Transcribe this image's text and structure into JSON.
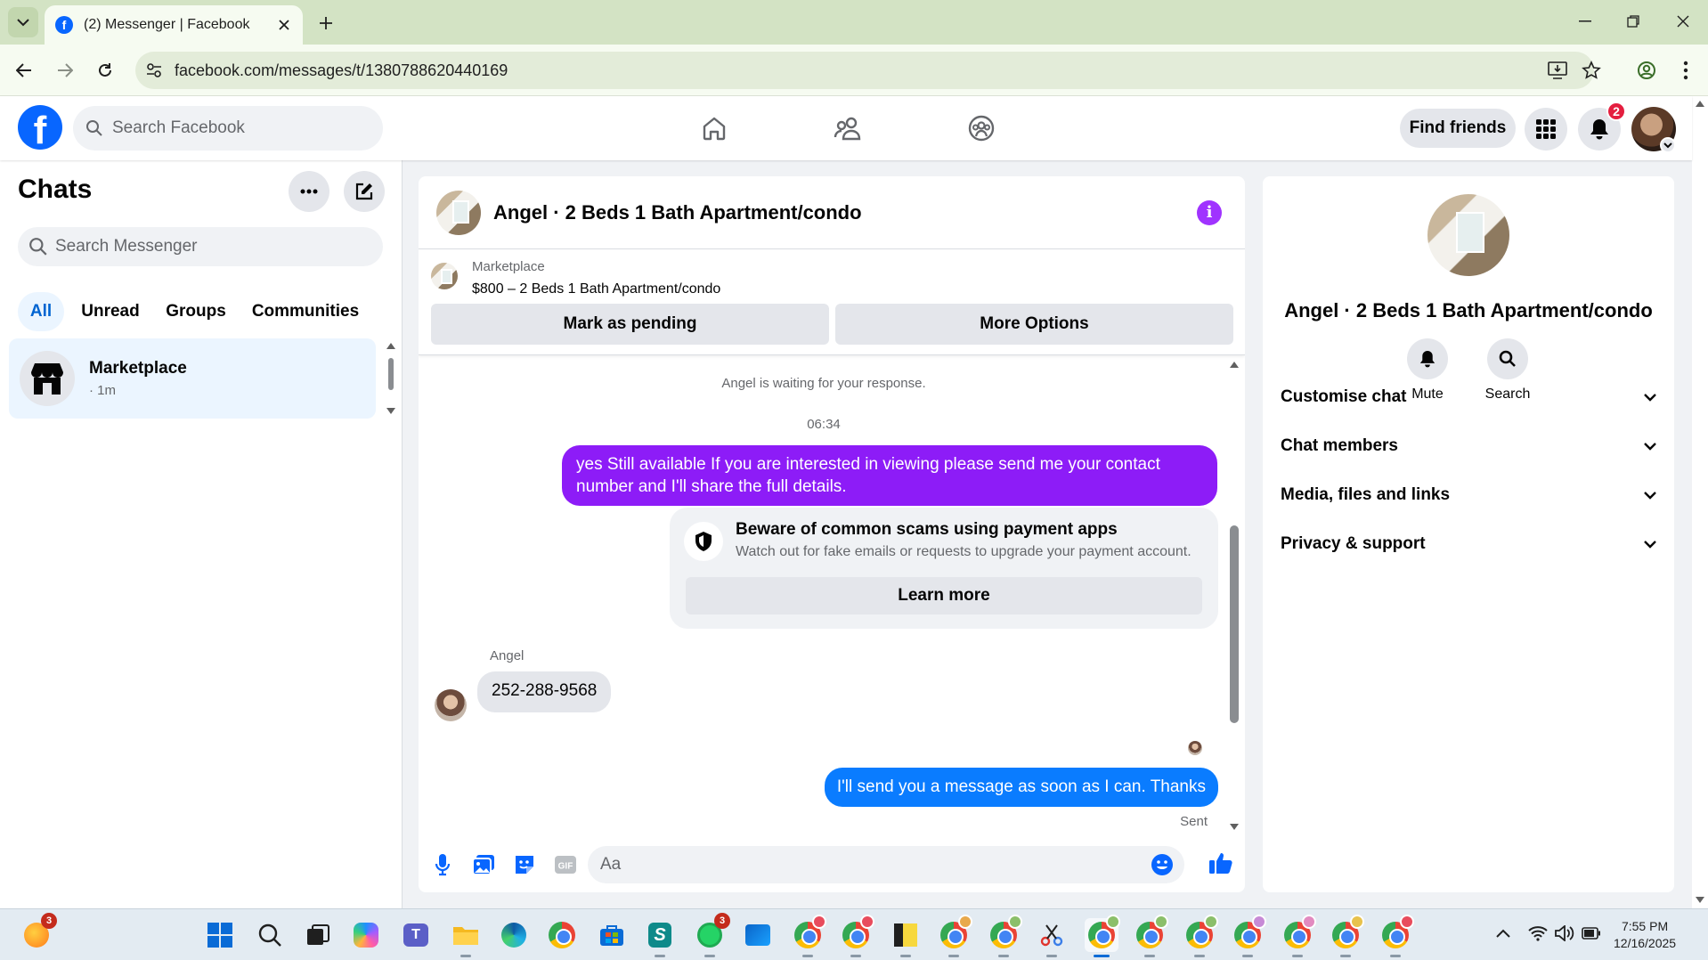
{
  "browser": {
    "tab_title": "(2) Messenger | Facebook",
    "url": "facebook.com/messages/t/1380788620440169"
  },
  "header": {
    "search_placeholder": "Search Facebook",
    "find_friends": "Find friends",
    "notification_count": "2",
    "brand_color": "#0866ff"
  },
  "sidebar": {
    "title": "Chats",
    "search_placeholder": "Search Messenger",
    "filters": [
      "All",
      "Unread",
      "Groups",
      "Communities"
    ],
    "conversations": [
      {
        "name": "Marketplace",
        "time": "· 1m"
      }
    ]
  },
  "chat": {
    "title": "Angel · 2 Beds 1 Bath Apartment/condo",
    "marketplace_label": "Marketplace",
    "listing": "$800 – 2 Beds 1 Bath Apartment/condo",
    "mark_pending": "Mark as pending",
    "more_options": "More Options",
    "waiting_text": "Angel is waiting for your response.",
    "timestamp": "06:34",
    "messages": [
      {
        "from": "me",
        "text": "yes Still available If you are interested in viewing please send me your contact number and I'll share the full details."
      },
      {
        "from": "Angel",
        "text": "252-288-9568"
      },
      {
        "from": "me",
        "text": "I'll send you a message as soon as I can. Thanks"
      }
    ],
    "scam_title": "Beware of common scams using payment apps",
    "scam_desc": "Watch out for fake emails or requests to upgrade your payment account.",
    "learn_more": "Learn more",
    "sender_name": "Angel",
    "sent_label": "Sent",
    "composer_placeholder": "Aa",
    "gif_label": "GIF",
    "outgoing_color": "#8d1cf7",
    "outgoing_blue": "#0a7cff"
  },
  "info": {
    "title": "Angel · 2 Beds 1 Bath Apartment/condo",
    "actions": [
      "Mute",
      "Search"
    ],
    "sections": [
      "Customise chat",
      "Chat members",
      "Media, files and links",
      "Privacy & support"
    ]
  },
  "taskbar": {
    "time": "7:55 PM",
    "date": "12/16/2025",
    "badge_start": "3",
    "badge_whatsapp": "3"
  }
}
